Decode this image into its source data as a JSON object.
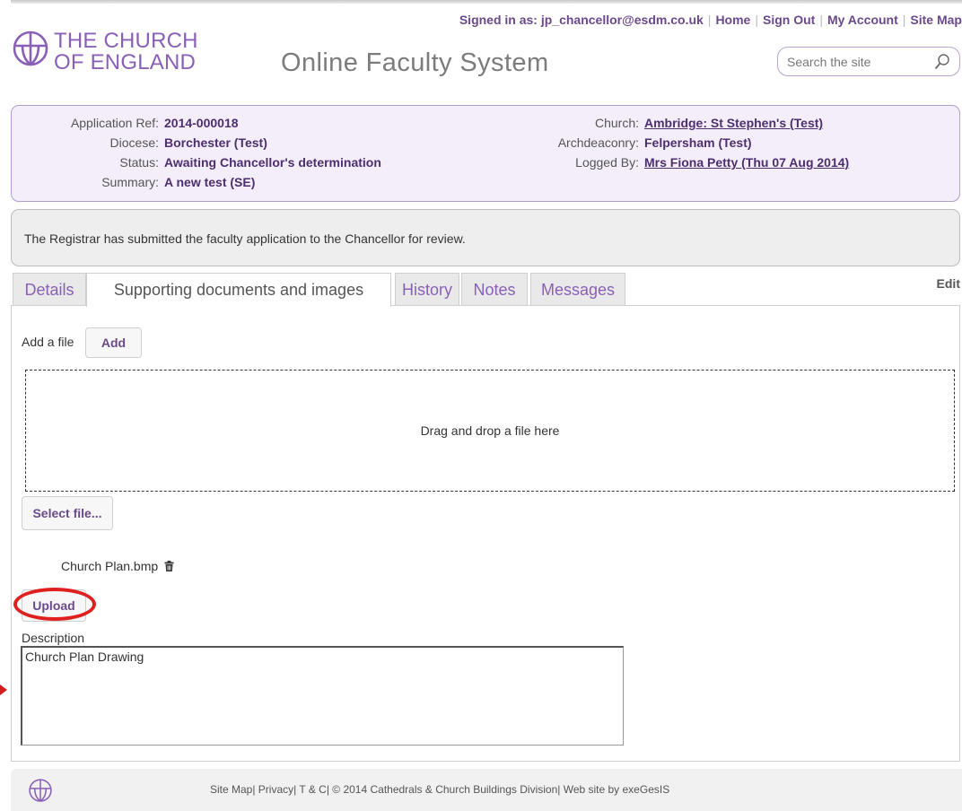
{
  "header": {
    "signed_in": "Signed in as: jp_chancellor@esdm.co.uk",
    "links": [
      "Home",
      "Sign Out",
      "My Account",
      "Site Map"
    ],
    "logo_line1": "THE CHURCH",
    "logo_line2": "OF ENGLAND",
    "site_title": "Online Faculty System",
    "search_placeholder": "Search the site"
  },
  "application": {
    "left": [
      {
        "label": "Application Ref:",
        "value": "2014-000018",
        "link": false
      },
      {
        "label": "Diocese:",
        "value": "Borchester (Test)",
        "link": false
      },
      {
        "label": "Status:",
        "value": "Awaiting Chancellor's determination",
        "link": false
      },
      {
        "label": "Summary:",
        "value": "A new test (SE)",
        "link": false
      }
    ],
    "right": [
      {
        "label": "Church:",
        "value": "Ambridge: St Stephen's (Test)",
        "link": true
      },
      {
        "label": "Archdeaconry:",
        "value": "Felpersham (Test)",
        "link": false
      },
      {
        "label": "Logged By:",
        "value": "Mrs Fiona Petty (Thu 07 Aug 2014)",
        "link": true
      }
    ]
  },
  "notice": "The Registrar has submitted the faculty application to the Chancellor for review.",
  "tabs": {
    "details": "Details",
    "documents": "Supporting documents and images",
    "history": "History",
    "notes": "Notes",
    "messages": "Messages",
    "active": "Supporting documents and images"
  },
  "edit_label": "Edit",
  "upload": {
    "add_label": "Add a file",
    "add_button": "Add",
    "dropzone": "Drag and drop a file here",
    "select_button": "Select file...",
    "file_name": "Church Plan.bmp",
    "upload_button": "Upload",
    "description_label": "Description",
    "description_value": "Church Plan Drawing"
  },
  "footer": {
    "text": "Site Map| Privacy| T & C| © 2014 Cathedrals & Church Buildings Division| Web site by exeGesIS"
  },
  "colors": {
    "brand_purple": "#8a60b6",
    "dark_purple": "#4d2f6e",
    "highlight_red": "#e0201f"
  },
  "icons": [
    "church-logo-icon",
    "search-icon",
    "trash-icon"
  ]
}
